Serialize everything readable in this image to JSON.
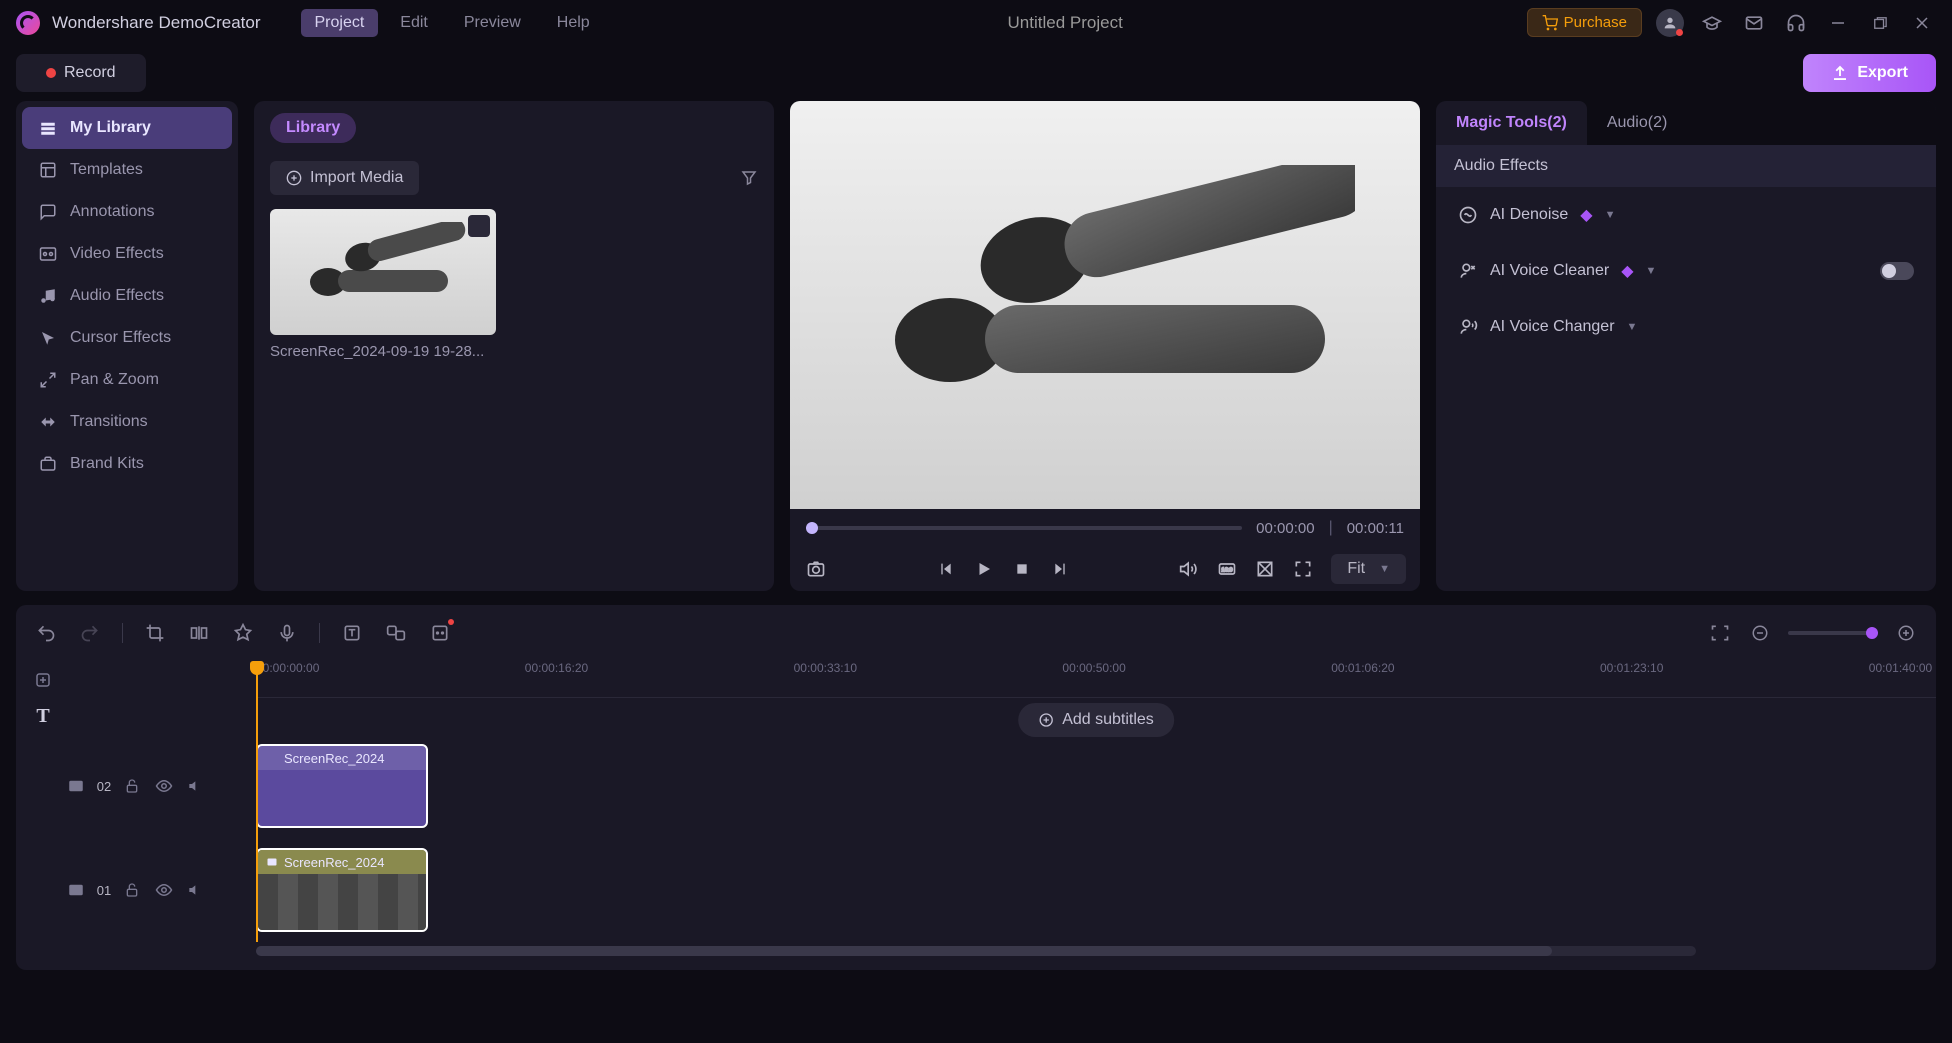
{
  "app": {
    "title": "Wondershare DemoCreator",
    "project": "Untitled Project"
  },
  "menu": [
    "Project",
    "Edit",
    "Preview",
    "Help"
  ],
  "menu_active": 0,
  "titlebar": {
    "purchase": "Purchase"
  },
  "subbar": {
    "record": "Record",
    "export": "Export"
  },
  "sidebar": [
    {
      "icon": "library",
      "label": "My Library"
    },
    {
      "icon": "templates",
      "label": "Templates"
    },
    {
      "icon": "annotations",
      "label": "Annotations"
    },
    {
      "icon": "video-fx",
      "label": "Video Effects"
    },
    {
      "icon": "audio-fx",
      "label": "Audio Effects"
    },
    {
      "icon": "cursor-fx",
      "label": "Cursor Effects"
    },
    {
      "icon": "panzoom",
      "label": "Pan & Zoom"
    },
    {
      "icon": "transitions",
      "label": "Transitions"
    },
    {
      "icon": "brand",
      "label": "Brand Kits"
    }
  ],
  "sidebar_active": 0,
  "library": {
    "title": "Library",
    "import": "Import Media",
    "clip_name": "ScreenRec_2024-09-19 19-28..."
  },
  "preview": {
    "current": "00:00:00",
    "total": "00:00:11",
    "fit_label": "Fit"
  },
  "props": {
    "tabs": [
      "Magic Tools(2)",
      "Audio(2)"
    ],
    "tab_active": 0,
    "section": "Audio Effects",
    "items": [
      {
        "label": "AI Denoise",
        "premium": true,
        "toggle": null
      },
      {
        "label": "AI Voice Cleaner",
        "premium": true,
        "toggle": false
      },
      {
        "label": "AI Voice Changer",
        "premium": false,
        "toggle": null
      }
    ]
  },
  "timeline": {
    "ticks": [
      "00:00:00:00",
      "00:00:16:20",
      "00:00:33:10",
      "00:00:50:00",
      "00:01:06:20",
      "00:01:23:10",
      "00:01:40:00"
    ],
    "add_subtitles": "Add subtitles",
    "tracks": [
      {
        "num": "02",
        "clip": "ScreenRec_2024"
      },
      {
        "num": "01",
        "clip": "ScreenRec_2024"
      }
    ]
  }
}
